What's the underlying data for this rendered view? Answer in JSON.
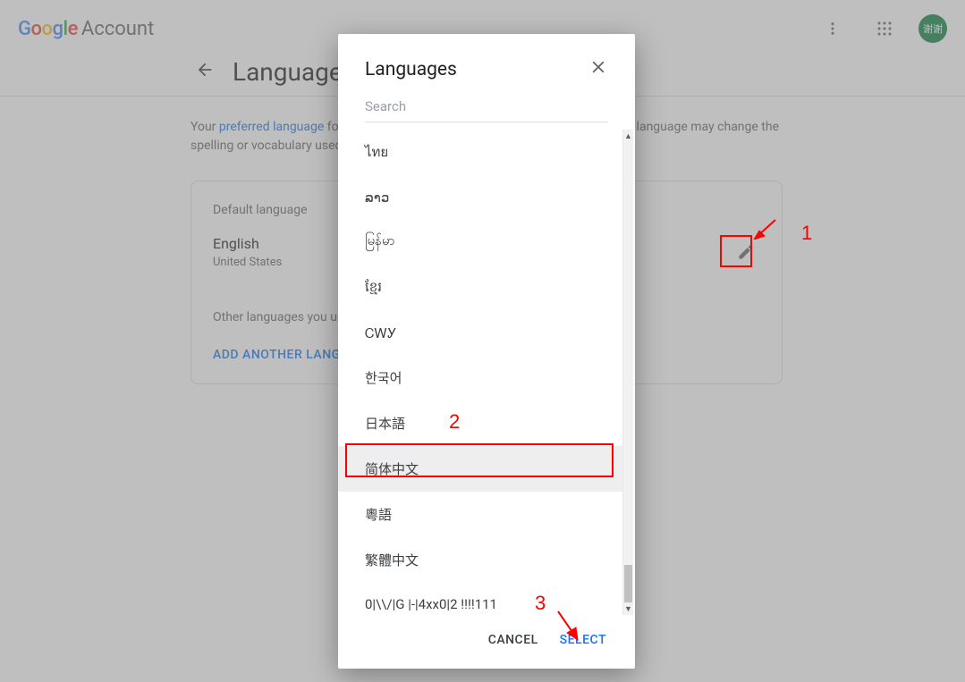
{
  "header": {
    "logo_google": "Google",
    "account": "Account",
    "avatar": "谢谢"
  },
  "page": {
    "title": "Language",
    "desc_prefix": "Your ",
    "desc_link": "preferred language",
    "desc_mid": " for Google products is shown first. Selecting a different language may change the spelling or vocabulary used by some of them.",
    "card": {
      "default_label": "Default language",
      "lang_name": "English",
      "lang_sub": "United States",
      "other_label": "Other languages you understand",
      "add": "ADD ANOTHER LANGUAGE"
    }
  },
  "modal": {
    "title": "Languages",
    "search_placeholder": "Search",
    "items": [
      "ไทย",
      "ລາວ",
      "မြန်မာ",
      "ខ្មែរ",
      "ᏟᎳᎩ",
      "한국어",
      "日本語",
      "简体中文",
      "粵語",
      "繁體中文",
      "0|\\\\/|G |-|4xx0|2 !!!!111"
    ],
    "selected_index": 7,
    "cancel": "CANCEL",
    "select": "SELECT"
  },
  "annotations": {
    "a1": "1",
    "a2": "2",
    "a3": "3"
  }
}
